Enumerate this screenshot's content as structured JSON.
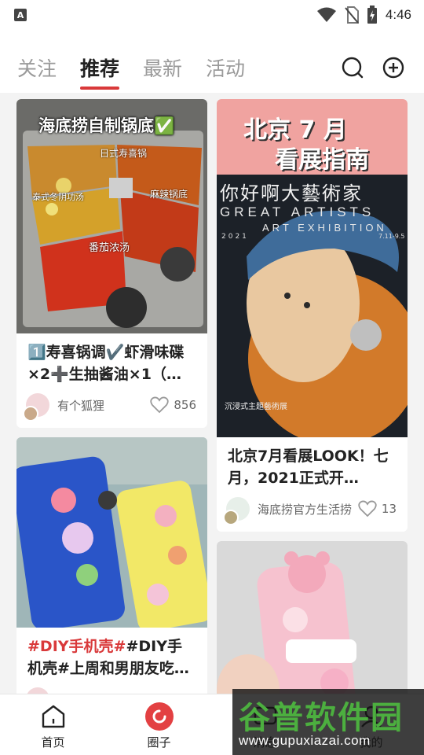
{
  "status_bar": {
    "time": "4:46",
    "app_badge": "A"
  },
  "tabs": [
    {
      "label": "关注"
    },
    {
      "label": "推荐"
    },
    {
      "label": "最新"
    },
    {
      "label": "活动"
    }
  ],
  "cards": [
    {
      "overlay_title": "海底捞自制锅底✅",
      "image_labels": [
        "日式寿喜锅",
        "泰式冬阴功汤",
        "麻辣锅底",
        "番茄浓汤"
      ],
      "title": "1️⃣寿喜锅调✔️虾滑味碟×2➕生抽酱油×1（…",
      "author": "有个狐狸",
      "likes": "856"
    },
    {
      "poster_title_1": "北京 7 月",
      "poster_title_2": "看展指南",
      "poster_subtitle": "你好啊大藝術家",
      "poster_en_1": "GREAT ARTISTS",
      "poster_en_2": "ART EXHIBITION",
      "poster_year": "2021",
      "poster_dates": "7.11-9.5",
      "poster_caption": "沉浸式主題藝術展",
      "title": "北京7月看展LOOK！七月，2021正式开…",
      "author": "海底捞官方生活捞",
      "likes": "13"
    },
    {
      "title_hl": "#DIY手机壳#",
      "title_rest": "#DIY手机壳#上周和男朋友吃…",
      "author": "",
      "likes": ""
    },
    {
      "title": "",
      "author": "",
      "likes": ""
    }
  ],
  "bottom_nav": [
    {
      "label": "首页"
    },
    {
      "label": "圈子"
    },
    {
      "label": "消息"
    },
    {
      "label": "我的"
    }
  ],
  "watermark": {
    "title": "谷普软件园",
    "url": "www.gupuxiazai.com"
  },
  "colors": {
    "accent": "#d9393a",
    "feed_bg": "#f3f3f3"
  }
}
